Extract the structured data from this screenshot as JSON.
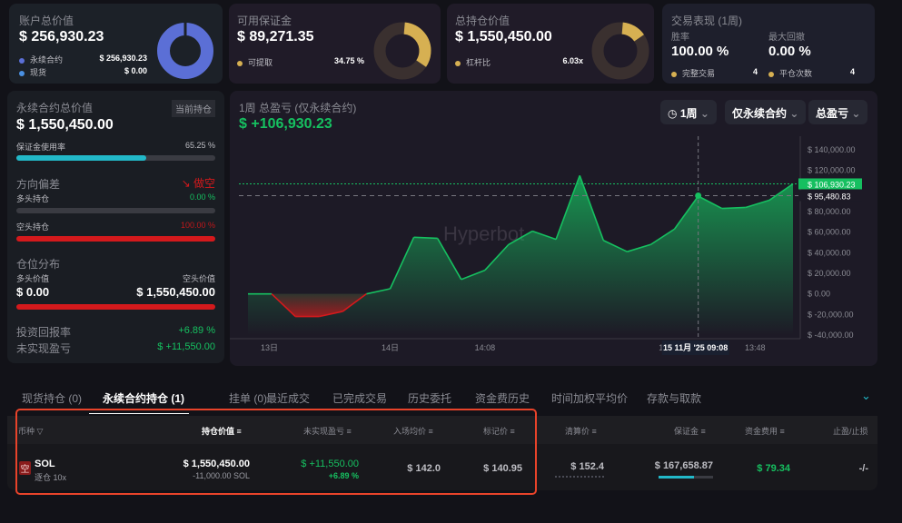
{
  "cards": {
    "account": {
      "title": "账户总价值",
      "value": "$ 256,930.23",
      "rows": [
        {
          "label": "永续合约",
          "value": "$ 256,930.23"
        },
        {
          "label": "现货",
          "value": "$ 0.00"
        }
      ]
    },
    "margin": {
      "title": "可用保证金",
      "value": "$ 89,271.35",
      "row": {
        "label": "可提取",
        "value": "34.75 %"
      }
    },
    "position": {
      "title": "总持仓价值",
      "value": "$ 1,550,450.00",
      "row": {
        "label": "杠杆比",
        "value": "6.03x"
      }
    },
    "perf": {
      "title": "交易表现 (1周)",
      "win_label": "胜率",
      "win": "100.00 %",
      "dd_label": "最大回撤",
      "dd": "0.00 %",
      "trades_label": "完整交易",
      "trades": "4",
      "close_label": "平仓次数",
      "close": "4"
    }
  },
  "left": {
    "title": "永续合约总价值",
    "badge": "当前持仓",
    "value": "$ 1,550,450.00",
    "margin_usage_label": "保证金使用率",
    "margin_usage": "65.25 %",
    "margin_usage_pct": 65.25,
    "bias_label": "方向偏差",
    "bias": "做空",
    "long_label": "多头持仓",
    "long_pct": "0.00 %",
    "short_label": "空头持仓",
    "short_pct": "100.00 %",
    "dist_label": "仓位分布",
    "long_val_label": "多头价值",
    "short_val_label": "空头价值",
    "long_val": "$ 0.00",
    "short_val": "$ 1,550,450.00",
    "roi_label": "投资回报率",
    "roi": "+6.89 %",
    "upnl_label": "未实现盈亏",
    "upnl": "$ +11,550.00"
  },
  "chart": {
    "title": "1周 总盈亏 (仅永续合约)",
    "value": "$ +106,930.23",
    "period": "1周",
    "scope": "仅永续合约",
    "metric": "总盈亏",
    "watermark": "Hyperbot",
    "crosshair_label": "15 11月 '25  09:08"
  },
  "chart_data": {
    "type": "area",
    "values": [
      0,
      0,
      -22000,
      -22000,
      -17000,
      0,
      5000,
      55000,
      54000,
      14000,
      23000,
      48000,
      61000,
      53000,
      115000,
      52000,
      41000,
      48000,
      63000,
      95000,
      83000,
      84000,
      91000,
      106930
    ],
    "ylim": [
      -40000,
      140000
    ],
    "yticks": [
      "$ 140,000.00",
      "$ 120,000.00",
      "$ 80,000.00",
      "$ 60,000.00",
      "$ 40,000.00",
      "$ 20,000.00",
      "$ 0.00",
      "$ -20,000.00",
      "$ -40,000.00"
    ],
    "ytick_values": [
      140000,
      120000,
      80000,
      60000,
      40000,
      20000,
      0,
      -20000,
      -40000
    ],
    "current_label": "$ 106,930.23",
    "current": 106930.23,
    "cross_label": "$ 95,480.83",
    "cross": 95480.83,
    "cross_index": 19,
    "xticks": [
      {
        "label": "13日",
        "i": 0.9
      },
      {
        "label": "14日",
        "i": 6
      },
      {
        "label": "14:08",
        "i": 10
      },
      {
        "label": "15日",
        "i": 17.7
      },
      {
        "label": "13:48",
        "i": 21.4
      }
    ],
    "grid": false
  },
  "tabs": [
    "现货持仓 (0)",
    "永续合约持仓 (1)",
    "挂单 (0)",
    "最近成交",
    "已完成交易",
    "历史委托",
    "资金费历史",
    "时间加权平均价",
    "存款与取款"
  ],
  "table": {
    "headers": [
      "币种",
      "持仓价值",
      "未实现盈亏",
      "入场均价",
      "标记价",
      "清算价",
      "保证金",
      "资金费用",
      "止盈/止损"
    ],
    "row": {
      "side": "空",
      "coin": "SOL",
      "mode": "逐仓 10x",
      "value": "$ 1,550,450.00",
      "size": "-11,000.00 SOL",
      "upnl": "$ +11,550.00",
      "upnl_pct": "+6.89 %",
      "entry": "$ 142.0",
      "mark": "$ 140.95",
      "liq": "$ 152.4",
      "margin": "$ 167,658.87",
      "funding": "$ 79.34",
      "tpsl": "-/-"
    }
  },
  "colors": {
    "green": "#16c060",
    "red": "#d4191c",
    "blue": "#5b6fd6",
    "gold": "#d6b052",
    "teal": "#22b8c8"
  }
}
